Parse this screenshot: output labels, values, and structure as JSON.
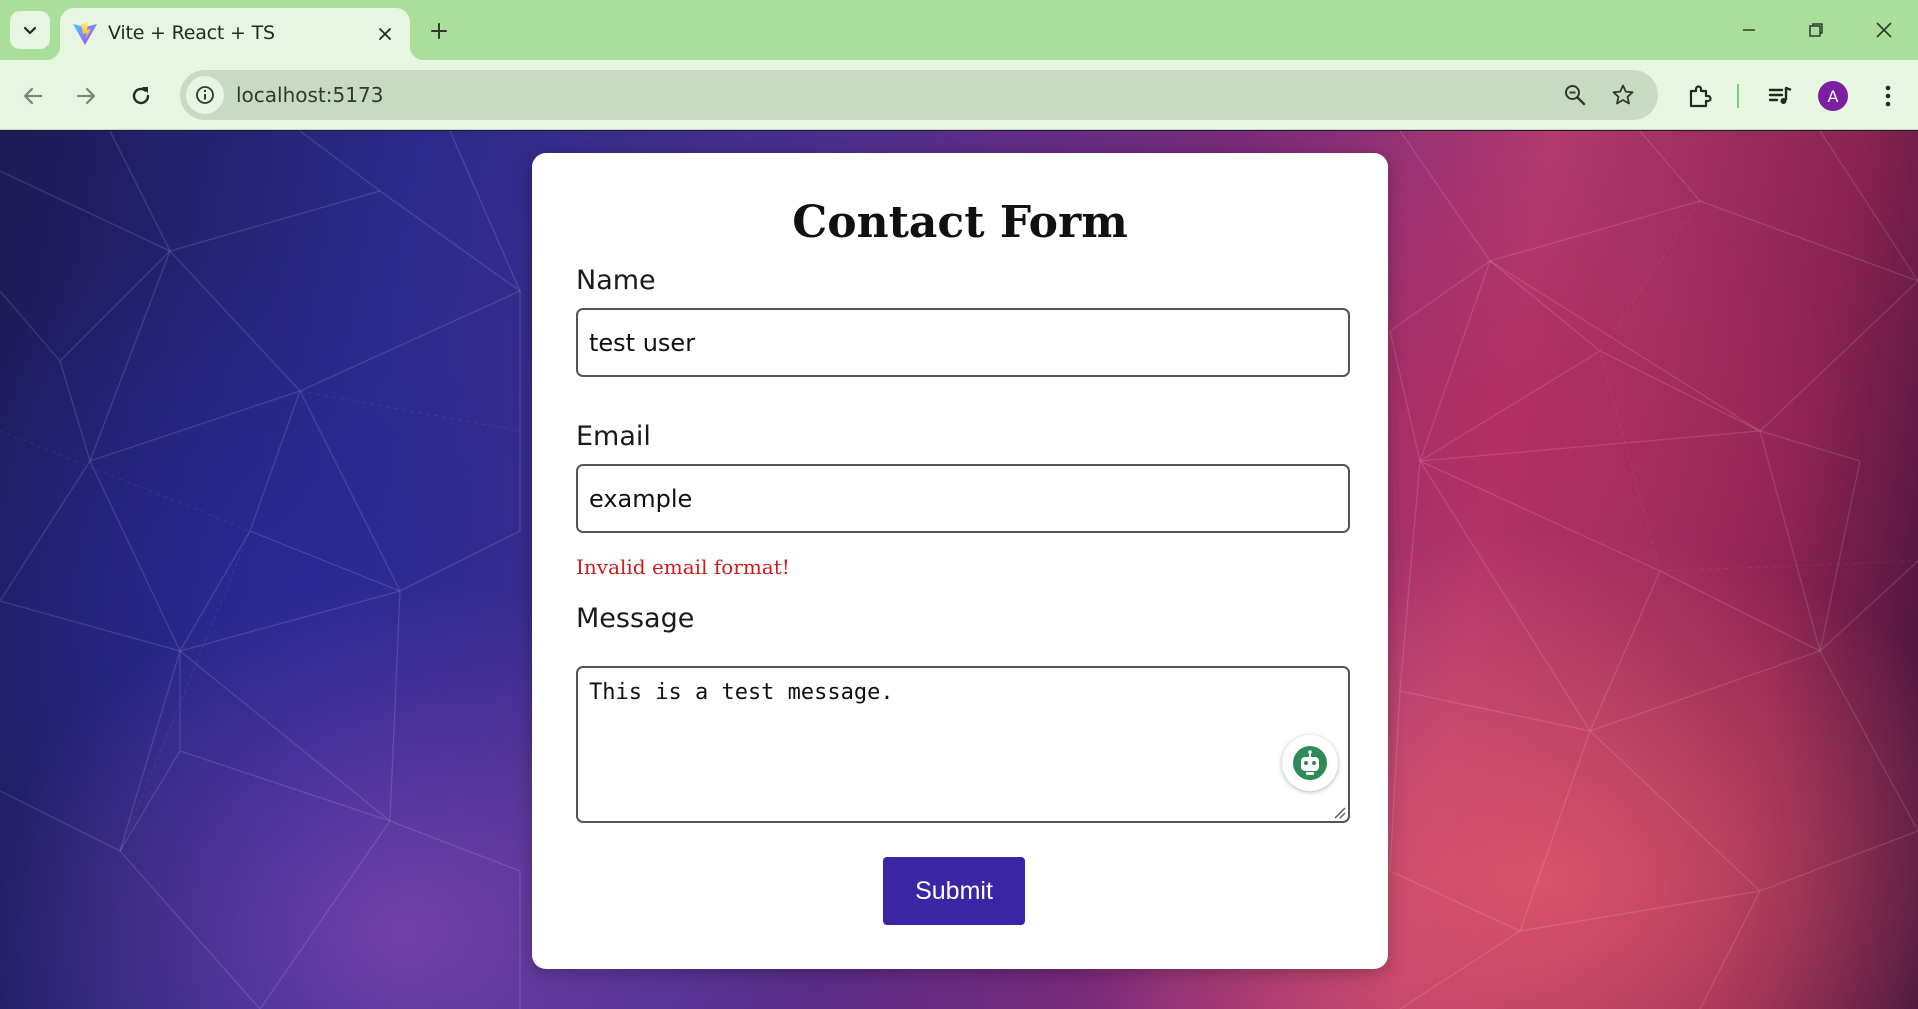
{
  "browser": {
    "tab_title": "Vite + React + TS",
    "url": "localhost:5173",
    "profile_initial": "A",
    "accent_color": "#a9df9b"
  },
  "icons": {
    "tab_search": "chevron-down-icon",
    "favicon": "vite-logo-icon",
    "tab_close": "close-icon",
    "new_tab": "plus-icon",
    "back": "arrow-left-icon",
    "forward": "arrow-right-icon",
    "reload": "reload-icon",
    "site_info": "info-icon",
    "zoom": "zoom-out-icon",
    "bookmark": "star-icon",
    "extensions": "puzzle-icon",
    "media": "media-queue-icon",
    "menu": "kebab-menu-icon",
    "grammar": "robot-assistant-icon"
  },
  "form": {
    "title": "Contact Form",
    "name_label": "Name",
    "name_value": "test user",
    "email_label": "Email",
    "email_value": "example",
    "email_error": "Invalid email format!",
    "message_label": "Message",
    "message_value": "This is a test message.",
    "submit_label": "Submit",
    "submit_color": "#3a25a5",
    "error_color": "#d11a1a"
  }
}
